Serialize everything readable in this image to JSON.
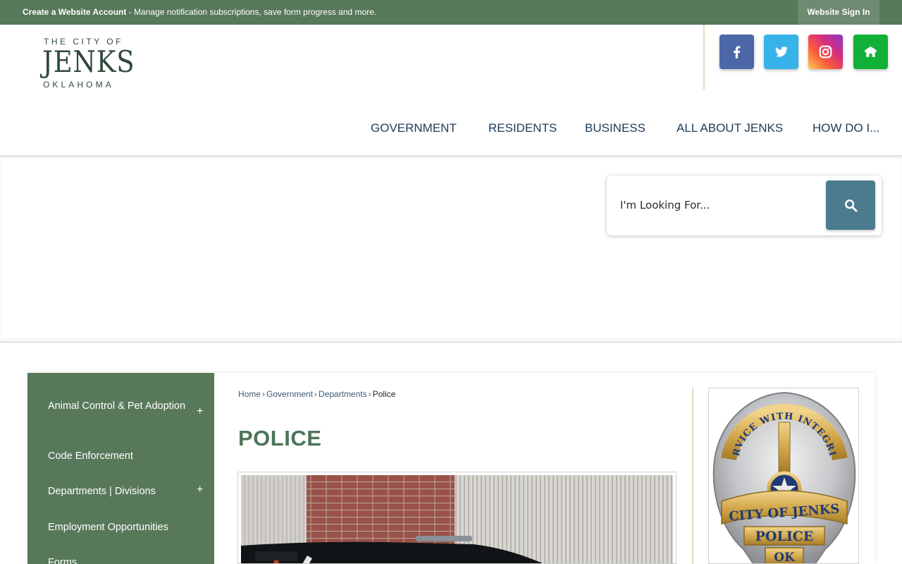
{
  "topbar": {
    "account_link": "Create a Website Account",
    "message": " - Manage notification subscriptions, save form progress and more.",
    "signin": "Website Sign In"
  },
  "logo": {
    "line1": "THE CITY OF",
    "line2": "JENKS",
    "line3": "OKLAHOMA"
  },
  "social": [
    {
      "name": "facebook",
      "icon": "facebook-icon",
      "color": "#4c67a8"
    },
    {
      "name": "twitter",
      "icon": "twitter-icon",
      "color": "#37b3ea"
    },
    {
      "name": "instagram",
      "icon": "instagram-icon",
      "color": "#d52e7f"
    },
    {
      "name": "nextdoor",
      "icon": "nextdoor-icon",
      "color": "#11b037"
    }
  ],
  "nav": [
    "GOVERNMENT",
    "RESIDENTS",
    "BUSINESS",
    "ALL ABOUT JENKS",
    "HOW DO I..."
  ],
  "search": {
    "placeholder": "I'm Looking For...",
    "button_icon": "search-icon"
  },
  "sidebar": {
    "items": [
      {
        "label": "Animal Control & Pet Adoption",
        "expandable": "+"
      },
      {
        "label": "Code Enforcement"
      },
      {
        "label": "Departments | Divisions",
        "expandable": "+"
      },
      {
        "label": "Employment Opportunities"
      },
      {
        "label": "Forms"
      }
    ]
  },
  "breadcrumb": [
    "Home",
    "Government",
    "Departments",
    "Police"
  ],
  "breadcrumb_sep": "›",
  "page": {
    "title": "POLICE"
  },
  "badge": {
    "top_text": "SERVICE WITH INTEGRITY",
    "banner_line1": "CITY OF JENKS",
    "banner_line2": "POLICE",
    "banner_line3": "OK"
  },
  "colors": {
    "brand_green": "#58785a",
    "title_green": "#4c7558",
    "search_button": "#4b7b8f",
    "nav_text": "#1d3b57"
  }
}
